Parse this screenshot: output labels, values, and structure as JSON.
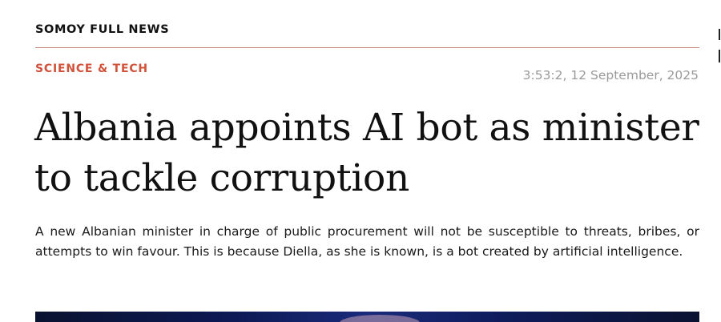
{
  "site": {
    "name": "SOMOY FULL NEWS"
  },
  "article": {
    "category": "SCIENCE & TECH",
    "timestamp": "3:53:2, 12 September, 2025",
    "headline": "Albania appoints AI bot as minister to tackle corruption",
    "summary": "A new Albanian minister in charge of public procurement will not be susceptible to threats, bribes, or attempts to win favour. This is because Diella, as she is known, is a bot created by artificial intelligence."
  },
  "colors": {
    "category": "#d0523a",
    "rule": "#c98a80",
    "timestamp": "#9a9a9a",
    "hero_image": "#0d1a55"
  }
}
